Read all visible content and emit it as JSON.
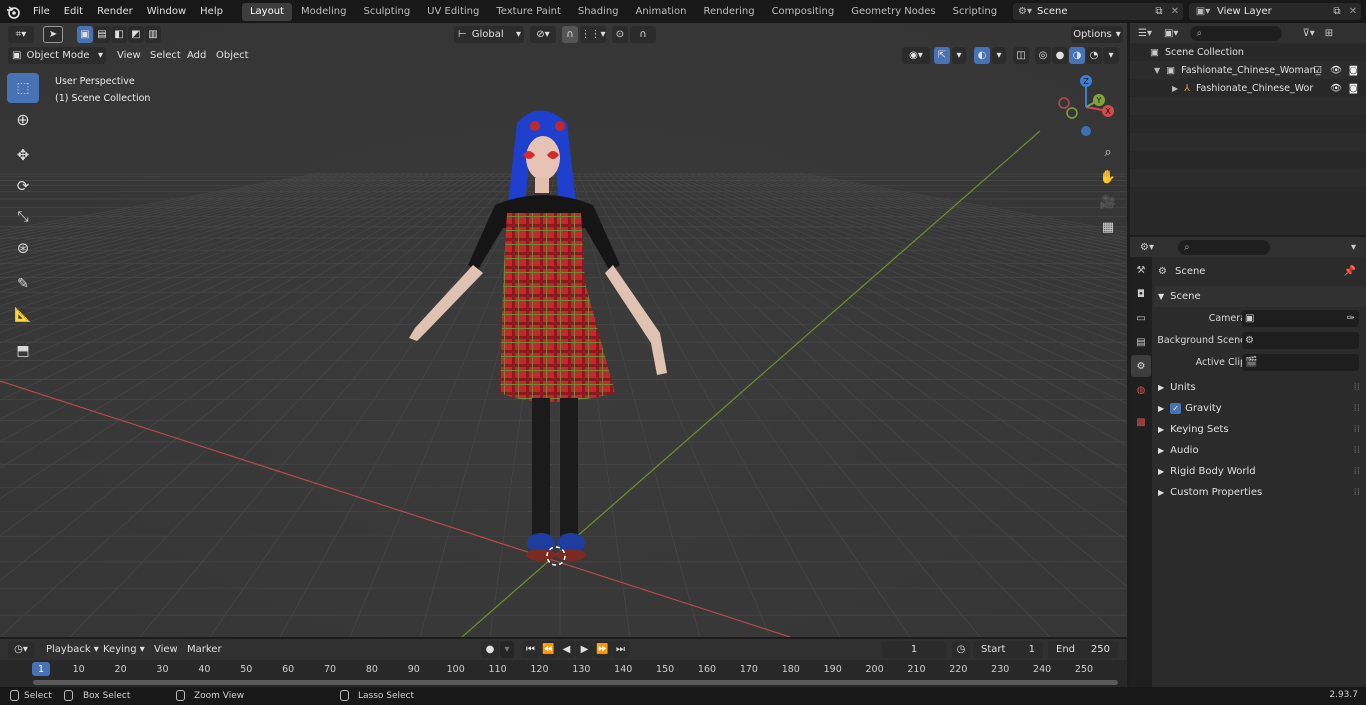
{
  "topbar": {
    "menus": [
      "File",
      "Edit",
      "Render",
      "Window",
      "Help"
    ],
    "workspaces": [
      "Layout",
      "Modeling",
      "Sculpting",
      "UV Editing",
      "Texture Paint",
      "Shading",
      "Animation",
      "Rendering",
      "Compositing",
      "Geometry Nodes",
      "Scripting"
    ],
    "active_workspace": "Layout",
    "scene_name": "Scene",
    "view_layer_name": "View Layer"
  },
  "viewport": {
    "mode": "Object Mode",
    "menus": [
      "View",
      "Select",
      "Add",
      "Object"
    ],
    "transform_orientation": "Global",
    "options_label": "Options",
    "overlay_line1": "User Perspective",
    "overlay_line2": "(1) Scene Collection",
    "gizmo_axes": {
      "x": "X",
      "y": "Y",
      "z": "Z"
    }
  },
  "outliner": {
    "rows": [
      {
        "label": "Scene Collection",
        "level": 0
      },
      {
        "label": "Fashionate_Chinese_Woman_",
        "level": 1
      },
      {
        "label": "Fashionate_Chinese_Wor",
        "level": 2
      }
    ]
  },
  "properties": {
    "context_title": "Scene",
    "section_title": "Scene",
    "fields": [
      {
        "label": "Camera",
        "value": ""
      },
      {
        "label": "Background Scene",
        "value": ""
      },
      {
        "label": "Active Clip",
        "value": ""
      }
    ],
    "panels": [
      "Units",
      "Gravity",
      "Keying Sets",
      "Audio",
      "Rigid Body World",
      "Custom Properties"
    ],
    "gravity_checked": true
  },
  "timeline": {
    "menus": [
      "Playback",
      "Keying",
      "View",
      "Marker"
    ],
    "current_frame": "1",
    "start_label": "Start",
    "start_value": "1",
    "end_label": "End",
    "end_value": "250",
    "ruler_ticks": [
      "1",
      "10",
      "20",
      "30",
      "40",
      "50",
      "60",
      "70",
      "80",
      "90",
      "100",
      "110",
      "120",
      "130",
      "140",
      "150",
      "160",
      "170",
      "180",
      "190",
      "200",
      "210",
      "220",
      "230",
      "240",
      "250"
    ]
  },
  "statusbar": {
    "items": [
      "Select",
      "Box Select",
      "Zoom View",
      "Lasso Select"
    ],
    "version": "2.93.7"
  },
  "colors": {
    "accent": "#4772b3",
    "x_axis": "#d14a4e",
    "y_axis": "#7fa33a",
    "z_axis": "#3e7fd6"
  }
}
